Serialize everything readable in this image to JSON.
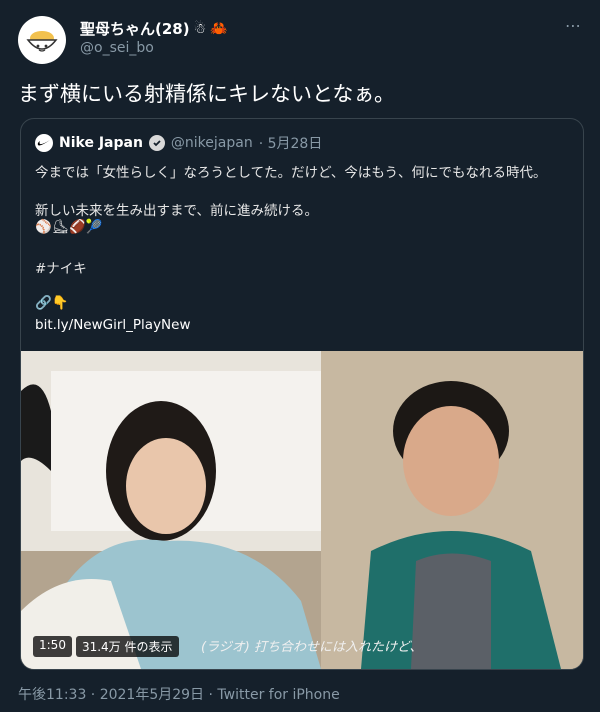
{
  "author": {
    "display_name": "聖母ちゃん(28)",
    "emoji_1": "☃",
    "emoji_2": "🦀",
    "handle": "@o_sei_bo",
    "avatar_icon": "rice-bowl-icon"
  },
  "more_icon": "⋯",
  "tweet_text": "まず横にいる射精係にキレないとなぁ。",
  "quote": {
    "name": "Nike Japan",
    "handle": "@nikejapan",
    "date": "· 5月28日",
    "lines": [
      "今までは「女性らしく」なろうとしてた。だけど、今はもう、何にでもなれる時代。",
      "新しい未来を生み出すまで、前に進み続ける。",
      "⚾⛸🏈🎾",
      "#ナイキ",
      "🔗👇",
      "bit.ly/NewGirl_PlayNew"
    ],
    "media": {
      "duration": "1:50",
      "views": "31.4万 件の表示",
      "caption": "(ラジオ) 打ち合わせには入れたけど、"
    }
  },
  "meta": "午後11:33 · 2021年5月29日 · Twitter for iPhone"
}
